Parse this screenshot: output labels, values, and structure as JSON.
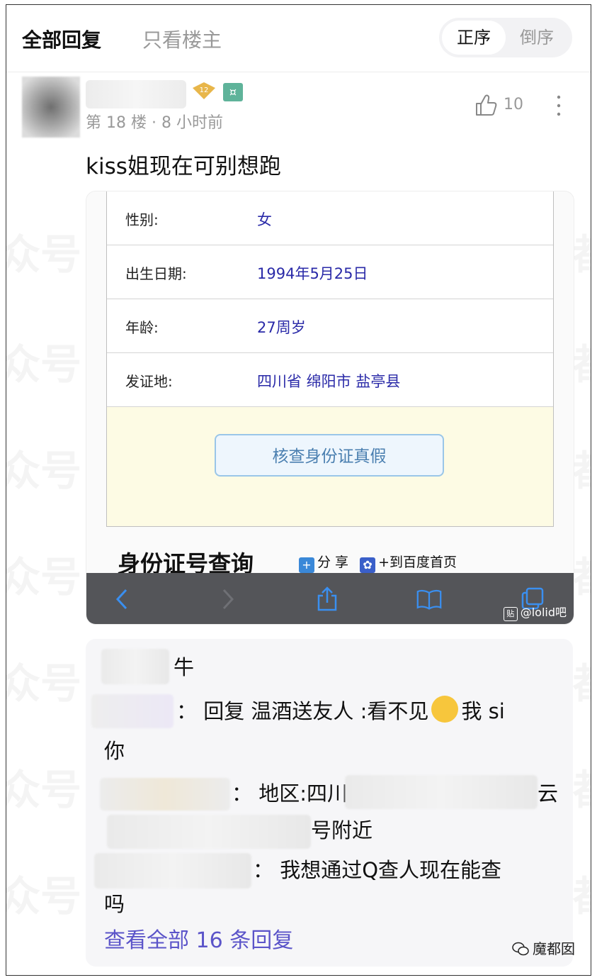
{
  "header": {
    "tab_all_replies": "全部回复",
    "tab_op_only": "只看楼主",
    "order_asc": "正序",
    "order_desc": "倒序"
  },
  "post": {
    "level_badge": "12",
    "floor_time": "第 18 楼 · 8 小时前",
    "like_count": "10",
    "text": "kiss姐现在可别想跑"
  },
  "embedded_screenshot": {
    "rows": [
      {
        "label": "性别:",
        "value": "女"
      },
      {
        "label": "出生日期:",
        "value": "1994年5月25日"
      },
      {
        "label": "年龄:",
        "value": "27周岁"
      },
      {
        "label": "发证地:",
        "value": "四川省 绵阳市 盐亭县"
      }
    ],
    "verify_button": "核查身份证真假",
    "page_title": "身份证号查询",
    "share_label": "分 享",
    "baidu_home_label": "+到百度首页",
    "watermark": "@lolid吧",
    "tie_label": "贴"
  },
  "replies": {
    "r1": "牛",
    "r2": "： 回复 温酒送友人 :看不见",
    "r2_tail": "我 si",
    "r2_line2": "你",
    "r3a": "： 地区:四川",
    "r3b": "云",
    "r3_line2": "号附近",
    "r4": "： 我想通过Q查人现在能查",
    "r4_line2": "吗",
    "see_all": "查看全部 16 条回复"
  },
  "watermarks": {
    "bg_text_1": "公众号：魔都囡",
    "bg_text_2": "众号：魔都囡",
    "corner": "魔都囡"
  }
}
